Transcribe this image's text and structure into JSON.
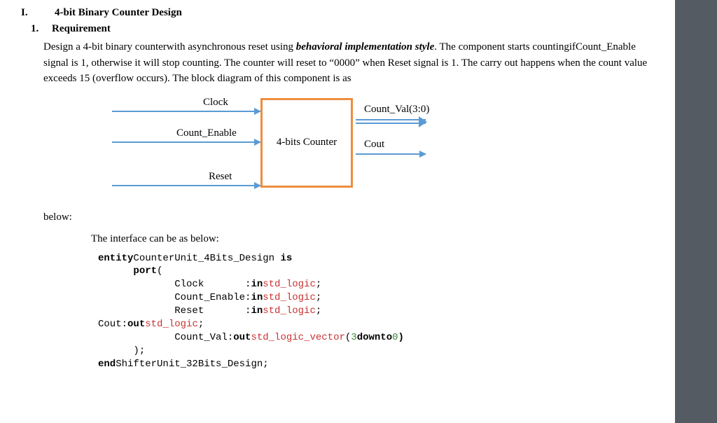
{
  "heading": {
    "sec_num": "I.",
    "sec_title": "4-bit Binary Counter Design",
    "sub_num": "1.",
    "sub_title": "Requirement"
  },
  "body": {
    "p1a": "Design a 4-bit binary counterwith asynchronous reset using ",
    "p1b": "behavioral implementation style",
    "p1c": ". The component starts countingifCount_Enable signal is 1, otherwise it will stop counting. The counter will reset to “0000” when Reset signal is 1. The carry out happens when the count value exceeds 15 (overflow occurs). The block diagram of this component is as"
  },
  "diagram": {
    "in1": "Clock",
    "in2": "Count_Enable",
    "in3": "Reset",
    "block": "4-bits Counter",
    "out1": "Count_Val(3:0)",
    "out2": "Cout"
  },
  "below": "below:",
  "iface_intro": "The interface can be as below:",
  "code": {
    "l1_kw1": "entity",
    "l1_id": "CounterUnit_4Bits_Design ",
    "l1_kw2": "is",
    "l2_kw": "port",
    "l2_p": "(",
    "l3_a": "Clock       :",
    "l3_kw": "in",
    "l3_ty": "std_logic",
    "l3_s": ";",
    "l4_a": "Count_Enable:",
    "l4_kw": "in",
    "l4_ty": "std_logic",
    "l4_s": ";",
    "l5_a": "Reset       :",
    "l5_kw": "in",
    "l5_ty": "std_logic",
    "l5_s": ";",
    "l6_a": "Cout:",
    "l6_kw": "out",
    "l6_ty": "std_logic",
    "l6_s": ";",
    "l7_a": "Count_Val:",
    "l7_kw": "out",
    "l7_ty": "std_logic_vector",
    "l7_p1": "(",
    "l7_n1": "3",
    "l7_kw2": "downto",
    "l7_n2": "0",
    "l7_p2": ")",
    "l8": ");",
    "l9_kw": "end",
    "l9_id": "ShifterUnit_32Bits_Design;"
  }
}
